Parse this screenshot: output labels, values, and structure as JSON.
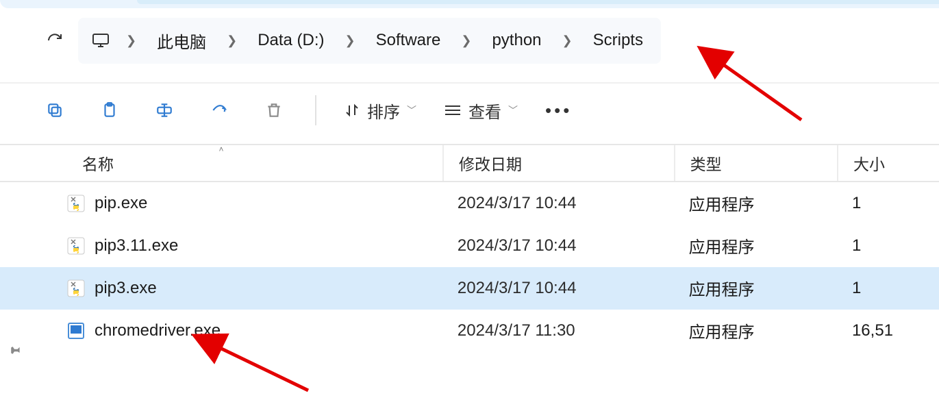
{
  "breadcrumb": {
    "root_icon": "pc",
    "items": [
      "此电脑",
      "Data (D:)",
      "Software",
      "python",
      "Scripts"
    ]
  },
  "toolbar": {
    "sort_label": "排序",
    "view_label": "查看"
  },
  "columns": {
    "name": "名称",
    "date": "修改日期",
    "type": "类型",
    "size": "大小"
  },
  "files": [
    {
      "icon": "py-exe",
      "name": "pip.exe",
      "date": "2024/3/17 10:44",
      "type": "应用程序",
      "size": "1",
      "selected": false
    },
    {
      "icon": "py-exe",
      "name": "pip3.11.exe",
      "date": "2024/3/17 10:44",
      "type": "应用程序",
      "size": "1",
      "selected": false
    },
    {
      "icon": "py-exe",
      "name": "pip3.exe",
      "date": "2024/3/17 10:44",
      "type": "应用程序",
      "size": "1",
      "selected": true
    },
    {
      "icon": "exe",
      "name": "chromedriver.exe",
      "date": "2024/3/17 11:30",
      "type": "应用程序",
      "size": "16,51",
      "selected": false
    }
  ]
}
